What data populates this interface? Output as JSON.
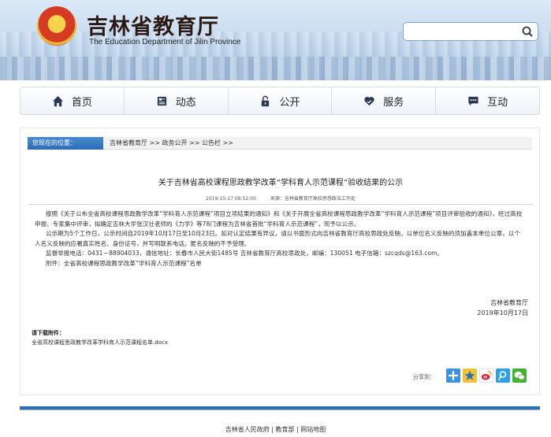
{
  "header": {
    "title": "吉林省教育厅",
    "subtitle": "The Education Department of Jilin Province",
    "search_placeholder": ""
  },
  "nav": {
    "items": [
      {
        "label": "首页",
        "icon": "home-icon"
      },
      {
        "label": "动态",
        "icon": "news-icon"
      },
      {
        "label": "公开",
        "icon": "lock-icon"
      },
      {
        "label": "服务",
        "icon": "heart-hand-icon"
      },
      {
        "label": "互动",
        "icon": "chat-icon"
      }
    ]
  },
  "breadcrumb": {
    "label": "您现在的位置：",
    "path": "吉林省教育厅 >> 政务公开 >> 公告栏 >>"
  },
  "article": {
    "title": "关于吉林省高校课程思政教学改革“学科育人示范课程”验收结果的公示",
    "datetime": "2019-10-17 08:52:00",
    "source": "来源：吉林省教育厅高校思想政治工作处",
    "paragraphs": [
      "按照《关于公布全省高校课程思政教学改革“学科育人示范课程”项目立项结果的通知》和《关于开展全省高校课程思政教学改革“学科育人示范课程”项目评审验收的通知》，经过高校申报、专家集中评审，拟确定吉林大学张汉壮老师的《力学》等78门课程为吉林省首批“学科育人示范课程”，现予以公示。",
      "公示期为5个工作日，公示时间自2019年10月17日至10月23日。如对认定结果有异议，请以书面形式向吉林省教育厅高校思政处反映。以单位名义反映的须加盖本单位公章，以个人名义反映的应署真实姓名、身份证号，并写明联系电话。匿名反映的不予受理。",
      "监督举报电话：0431－88904033，通信地址：长春市人民大街1485号 吉林省教育厅高校思政处，邮编：130051 电子信箱：szcqds@163.com。",
      "附件：全省高校课程思政教学改革“学科育人示范课程”名单"
    ],
    "sign_org": "吉林省教育厅",
    "sign_date": "2019年10月17日",
    "download_label": "请下载附件：",
    "download_file": "全省高校课程思政教学改革学科育人示范课程名单.docx",
    "share_label": "分享到：",
    "share_icons": [
      "qzone-icon",
      "favorite-star-icon",
      "weibo-icon",
      "tencent-weibo-icon",
      "wechat-icon"
    ]
  },
  "footer": {
    "links": "吉林省人民政府 | 教育部 | 网站地图"
  },
  "colors": {
    "accent": "#2f6fb8",
    "nav_icon": "#2a3a52"
  }
}
